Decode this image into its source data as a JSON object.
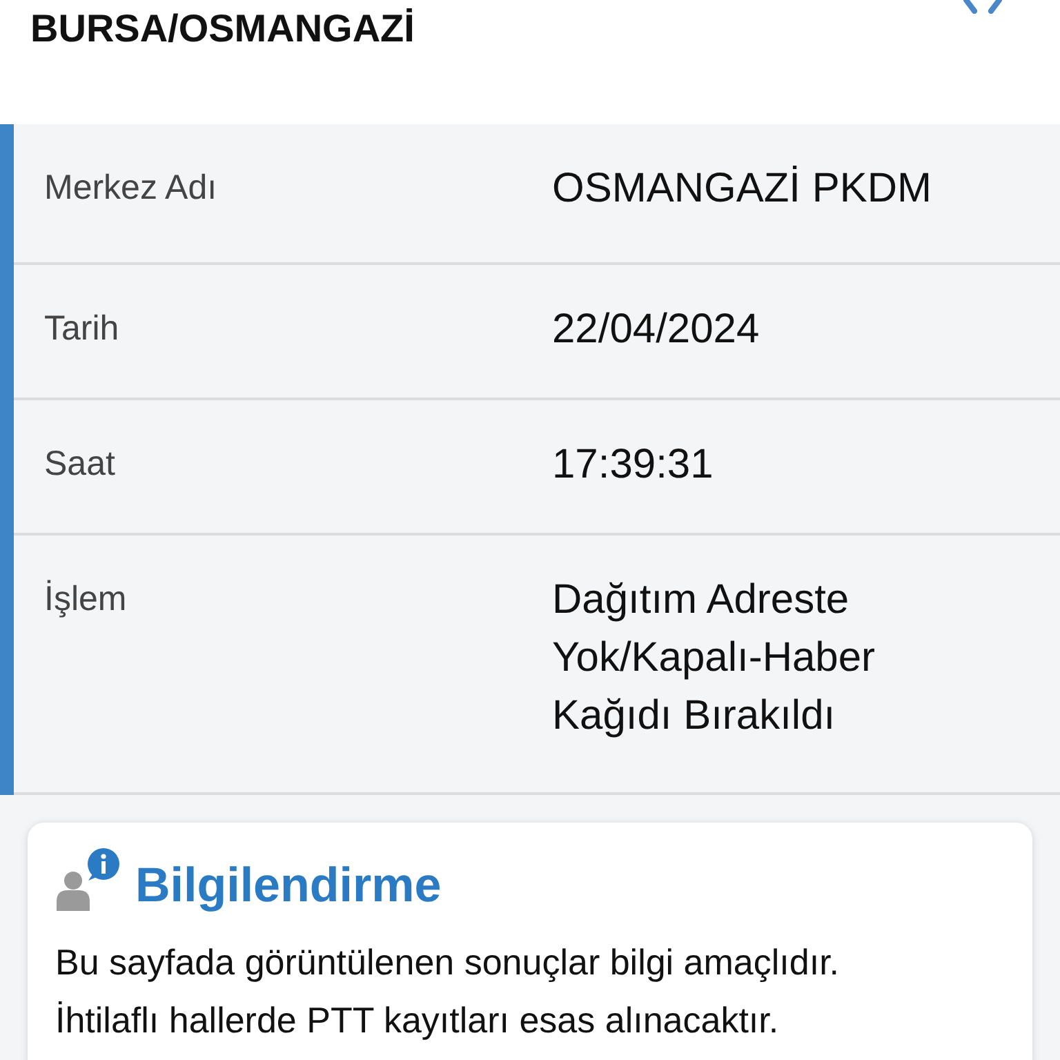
{
  "header": {
    "title": "BURSA/OSMANGAZİ"
  },
  "details": [
    {
      "label": "Merkez Adı",
      "value": "OSMANGAZİ PKDM"
    },
    {
      "label": "Tarih",
      "value": "22/04/2024"
    },
    {
      "label": "Saat",
      "value": "17:39:31"
    },
    {
      "label": "İşlem",
      "value": "Dağıtım Adreste Yok/Kapalı-Haber Kağıdı Bırakıldı"
    }
  ],
  "info": {
    "title": "Bilgilendirme",
    "lines": [
      "Bu sayfada görüntülenen sonuçlar bilgi amaçlıdır.",
      "İhtilaflı hallerde PTT kayıtları esas alınacaktır."
    ]
  }
}
